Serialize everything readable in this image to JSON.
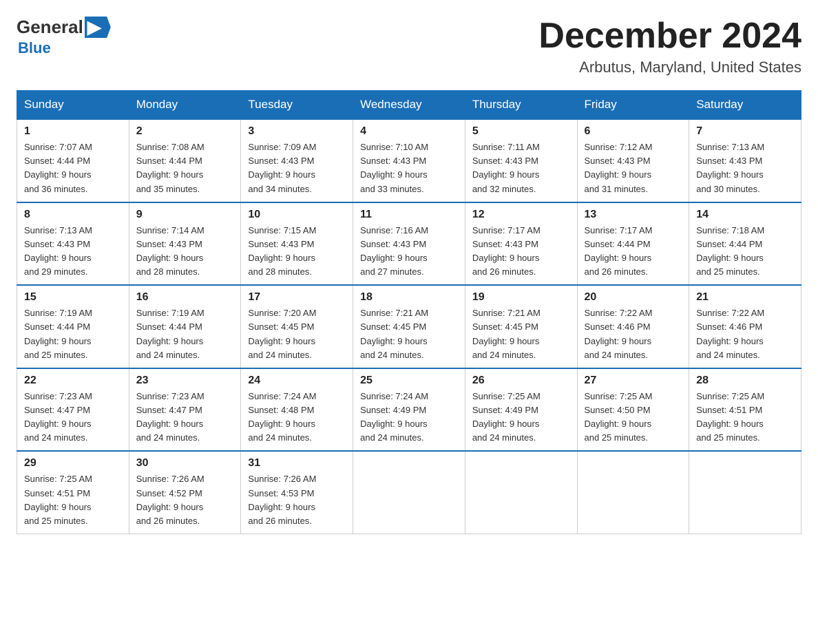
{
  "logo": {
    "general": "General",
    "blue": "Blue"
  },
  "title": "December 2024",
  "location": "Arbutus, Maryland, United States",
  "weekdays": [
    "Sunday",
    "Monday",
    "Tuesday",
    "Wednesday",
    "Thursday",
    "Friday",
    "Saturday"
  ],
  "weeks": [
    [
      {
        "day": "1",
        "sunrise": "7:07 AM",
        "sunset": "4:44 PM",
        "daylight": "9 hours and 36 minutes."
      },
      {
        "day": "2",
        "sunrise": "7:08 AM",
        "sunset": "4:44 PM",
        "daylight": "9 hours and 35 minutes."
      },
      {
        "day": "3",
        "sunrise": "7:09 AM",
        "sunset": "4:43 PM",
        "daylight": "9 hours and 34 minutes."
      },
      {
        "day": "4",
        "sunrise": "7:10 AM",
        "sunset": "4:43 PM",
        "daylight": "9 hours and 33 minutes."
      },
      {
        "day": "5",
        "sunrise": "7:11 AM",
        "sunset": "4:43 PM",
        "daylight": "9 hours and 32 minutes."
      },
      {
        "day": "6",
        "sunrise": "7:12 AM",
        "sunset": "4:43 PM",
        "daylight": "9 hours and 31 minutes."
      },
      {
        "day": "7",
        "sunrise": "7:13 AM",
        "sunset": "4:43 PM",
        "daylight": "9 hours and 30 minutes."
      }
    ],
    [
      {
        "day": "8",
        "sunrise": "7:13 AM",
        "sunset": "4:43 PM",
        "daylight": "9 hours and 29 minutes."
      },
      {
        "day": "9",
        "sunrise": "7:14 AM",
        "sunset": "4:43 PM",
        "daylight": "9 hours and 28 minutes."
      },
      {
        "day": "10",
        "sunrise": "7:15 AM",
        "sunset": "4:43 PM",
        "daylight": "9 hours and 28 minutes."
      },
      {
        "day": "11",
        "sunrise": "7:16 AM",
        "sunset": "4:43 PM",
        "daylight": "9 hours and 27 minutes."
      },
      {
        "day": "12",
        "sunrise": "7:17 AM",
        "sunset": "4:43 PM",
        "daylight": "9 hours and 26 minutes."
      },
      {
        "day": "13",
        "sunrise": "7:17 AM",
        "sunset": "4:44 PM",
        "daylight": "9 hours and 26 minutes."
      },
      {
        "day": "14",
        "sunrise": "7:18 AM",
        "sunset": "4:44 PM",
        "daylight": "9 hours and 25 minutes."
      }
    ],
    [
      {
        "day": "15",
        "sunrise": "7:19 AM",
        "sunset": "4:44 PM",
        "daylight": "9 hours and 25 minutes."
      },
      {
        "day": "16",
        "sunrise": "7:19 AM",
        "sunset": "4:44 PM",
        "daylight": "9 hours and 24 minutes."
      },
      {
        "day": "17",
        "sunrise": "7:20 AM",
        "sunset": "4:45 PM",
        "daylight": "9 hours and 24 minutes."
      },
      {
        "day": "18",
        "sunrise": "7:21 AM",
        "sunset": "4:45 PM",
        "daylight": "9 hours and 24 minutes."
      },
      {
        "day": "19",
        "sunrise": "7:21 AM",
        "sunset": "4:45 PM",
        "daylight": "9 hours and 24 minutes."
      },
      {
        "day": "20",
        "sunrise": "7:22 AM",
        "sunset": "4:46 PM",
        "daylight": "9 hours and 24 minutes."
      },
      {
        "day": "21",
        "sunrise": "7:22 AM",
        "sunset": "4:46 PM",
        "daylight": "9 hours and 24 minutes."
      }
    ],
    [
      {
        "day": "22",
        "sunrise": "7:23 AM",
        "sunset": "4:47 PM",
        "daylight": "9 hours and 24 minutes."
      },
      {
        "day": "23",
        "sunrise": "7:23 AM",
        "sunset": "4:47 PM",
        "daylight": "9 hours and 24 minutes."
      },
      {
        "day": "24",
        "sunrise": "7:24 AM",
        "sunset": "4:48 PM",
        "daylight": "9 hours and 24 minutes."
      },
      {
        "day": "25",
        "sunrise": "7:24 AM",
        "sunset": "4:49 PM",
        "daylight": "9 hours and 24 minutes."
      },
      {
        "day": "26",
        "sunrise": "7:25 AM",
        "sunset": "4:49 PM",
        "daylight": "9 hours and 24 minutes."
      },
      {
        "day": "27",
        "sunrise": "7:25 AM",
        "sunset": "4:50 PM",
        "daylight": "9 hours and 25 minutes."
      },
      {
        "day": "28",
        "sunrise": "7:25 AM",
        "sunset": "4:51 PM",
        "daylight": "9 hours and 25 minutes."
      }
    ],
    [
      {
        "day": "29",
        "sunrise": "7:25 AM",
        "sunset": "4:51 PM",
        "daylight": "9 hours and 25 minutes."
      },
      {
        "day": "30",
        "sunrise": "7:26 AM",
        "sunset": "4:52 PM",
        "daylight": "9 hours and 26 minutes."
      },
      {
        "day": "31",
        "sunrise": "7:26 AM",
        "sunset": "4:53 PM",
        "daylight": "9 hours and 26 minutes."
      },
      null,
      null,
      null,
      null
    ]
  ],
  "labels": {
    "sunrise": "Sunrise:",
    "sunset": "Sunset:",
    "daylight": "Daylight:"
  }
}
